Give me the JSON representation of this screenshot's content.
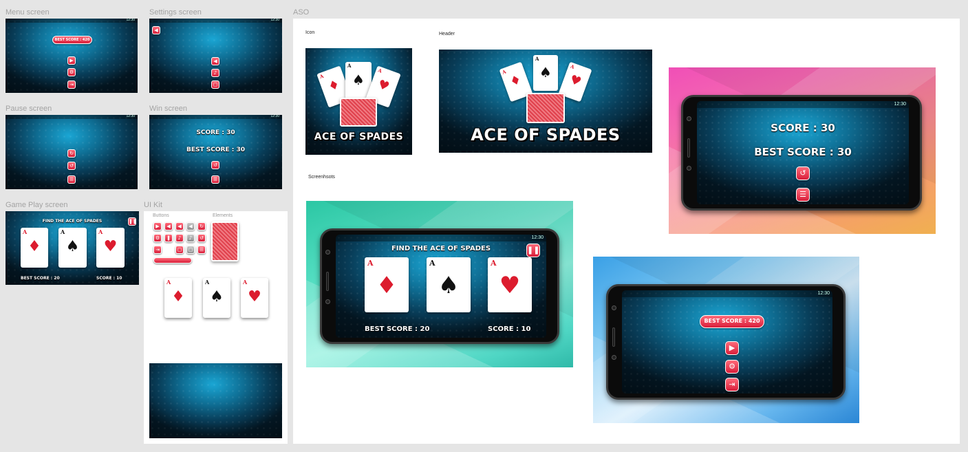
{
  "boards": {
    "menu": "Menu screen",
    "settings": "Settings screen",
    "pause": "Pause screen",
    "win": "Win screen",
    "gameplay": "Game Play screen",
    "uikit": "UI Kit",
    "aso": "ASO"
  },
  "status_time": "12:30",
  "menu": {
    "best_score": "BEST SCORE : 420"
  },
  "win": {
    "score": "SCORE : 30",
    "best_score": "BEST SCORE : 30"
  },
  "gameplay": {
    "title": "FIND THE ACE OF SPADES",
    "best_score": "BEST SCORE : 20",
    "score": "SCORE : 10"
  },
  "cards": {
    "rank": "A"
  },
  "uikit": {
    "buttons_label": "Buttons",
    "elements_label": "Elements"
  },
  "aso": {
    "icon_label": "Icon",
    "header_label": "Header",
    "screenshots_label": "Screenhsots",
    "game_title": "ACE OF SPADES"
  },
  "icons": {
    "play": "play-icon",
    "settings": "gear-icon",
    "exit": "exit-icon",
    "back": "back-icon",
    "sound": "speaker-icon",
    "music": "music-note-icon",
    "vibration": "vibration-icon",
    "pause": "pause-icon",
    "restart": "restart-icon",
    "menu": "list-icon"
  },
  "colors": {
    "accent_red": "#dc1c2e",
    "screen_blue": "#0f6f95",
    "canvas": "#e5e5e5"
  }
}
